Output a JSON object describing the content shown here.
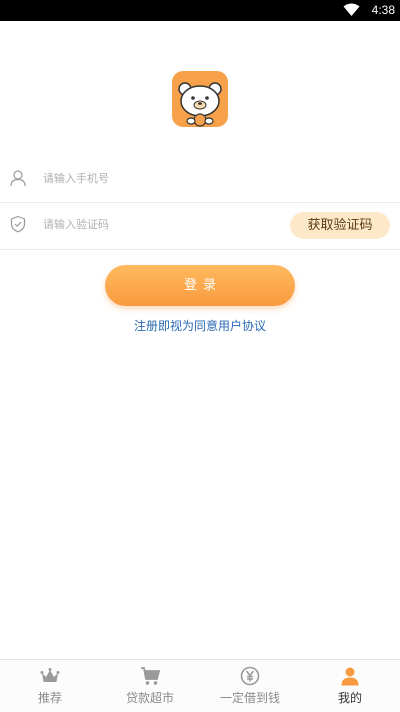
{
  "status_bar": {
    "time": "4:38"
  },
  "login": {
    "phone_placeholder": "请输入手机号",
    "code_placeholder": "请输入验证码",
    "get_code_label": "获取验证码",
    "login_label": "登录",
    "agreement_text": "注册即视为同意用户协议"
  },
  "tabs": [
    {
      "label": "推荐",
      "icon": "crown-icon",
      "active": false
    },
    {
      "label": "贷款超市",
      "icon": "cart-icon",
      "active": false
    },
    {
      "label": "一定借到钱",
      "icon": "yen-icon",
      "active": false
    },
    {
      "label": "我的",
      "icon": "user-icon",
      "active": true
    }
  ],
  "colors": {
    "accent": "#f89a3f",
    "accent_light": "#fde8c9",
    "link": "#2a6ab5",
    "tab_inactive": "#8a8a8a"
  }
}
